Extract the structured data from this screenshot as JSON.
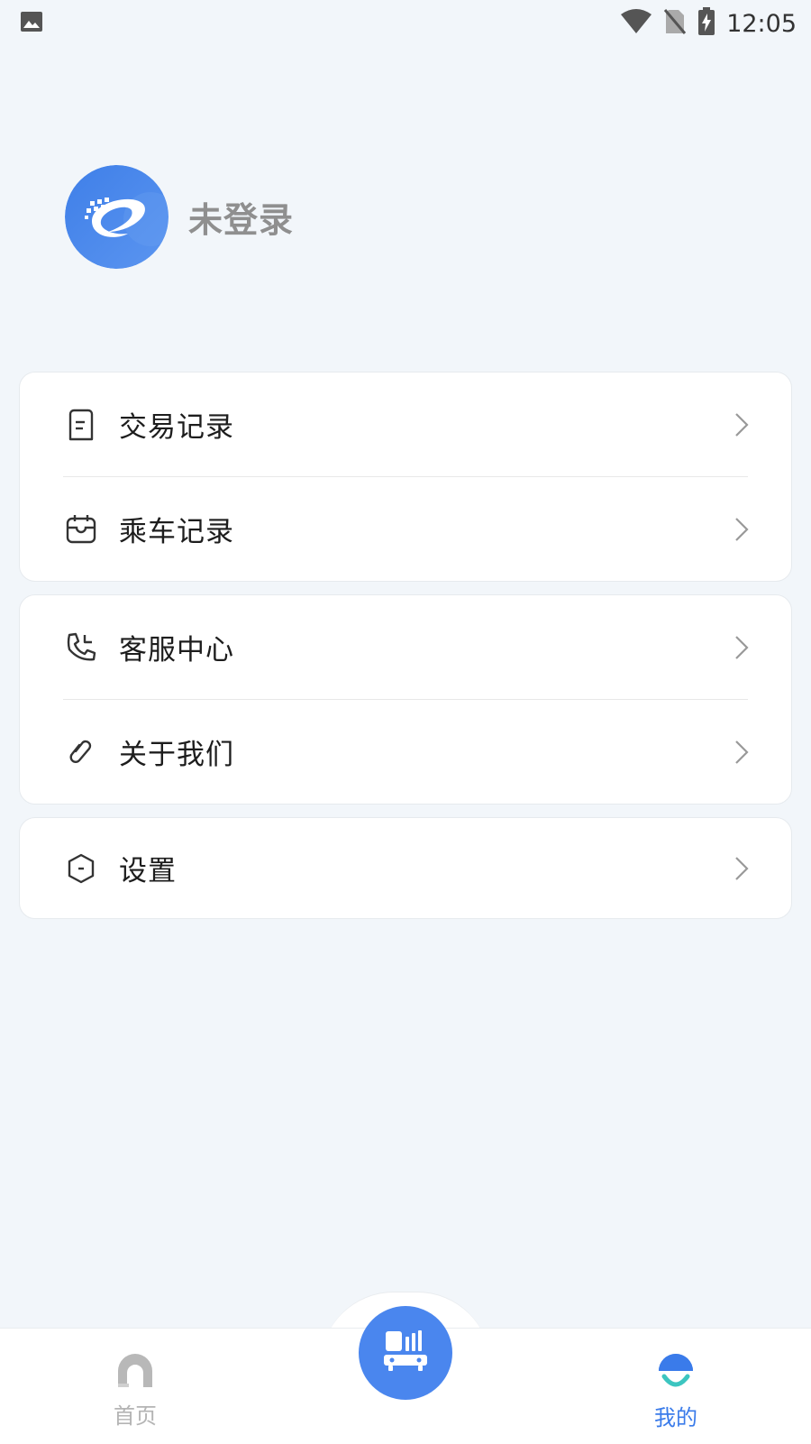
{
  "status_bar": {
    "time": "12:05",
    "icons": [
      "image-icon",
      "wifi-icon",
      "no-sim-icon",
      "battery-charging-icon"
    ]
  },
  "profile": {
    "name": "未登录"
  },
  "menu_groups": [
    {
      "items": [
        {
          "label": "交易记录",
          "icon": "receipt-icon"
        },
        {
          "label": "乘车记录",
          "icon": "ride-ticket-icon"
        }
      ]
    },
    {
      "items": [
        {
          "label": "客服中心",
          "icon": "phone-icon"
        },
        {
          "label": "关于我们",
          "icon": "link-icon"
        }
      ]
    },
    {
      "items": [
        {
          "label": "设置",
          "icon": "settings-hexagon-icon"
        }
      ]
    }
  ],
  "bottom_nav": {
    "home_label": "首页",
    "mine_label": "我的",
    "active": "我的",
    "center_icon": "bus-qr-icon"
  },
  "colors": {
    "accent": "#4a86ee",
    "background": "#f2f6fa",
    "inactive": "#b4b4b4"
  }
}
